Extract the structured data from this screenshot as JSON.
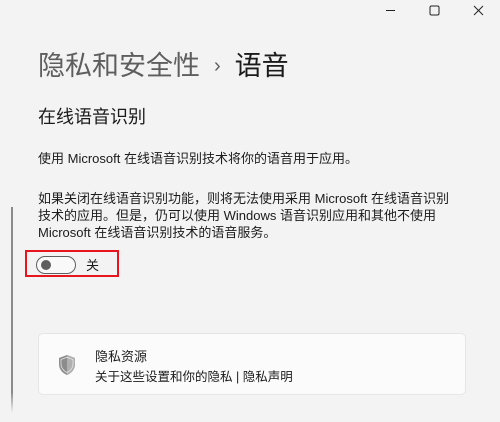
{
  "window": {
    "controls": [
      "minimize-icon",
      "maximize-icon",
      "close-icon"
    ]
  },
  "breadcrumb": {
    "parent": "隐私和安全性",
    "separator": "›",
    "current": "语音"
  },
  "section": {
    "title": "在线语音识别",
    "description": "使用 Microsoft 在线语音识别技术将你的语音用于应用。",
    "paragraph": "如果关闭在线语音识别功能，则将无法使用采用 Microsoft 在线语音识别技术的应用。但是，仍可以使用 Windows 语音识别应用和其他不使用 Microsoft 在线语音识别技术的语音服务。"
  },
  "toggle": {
    "state": "off",
    "label": "关"
  },
  "privacy_card": {
    "icon": "shield-icon",
    "title": "隐私资源",
    "link": "关于这些设置和你的隐私",
    "link_tail": "隐私声明"
  },
  "colors": {
    "highlight": "#e8141e",
    "background": "#f3f3f3"
  }
}
